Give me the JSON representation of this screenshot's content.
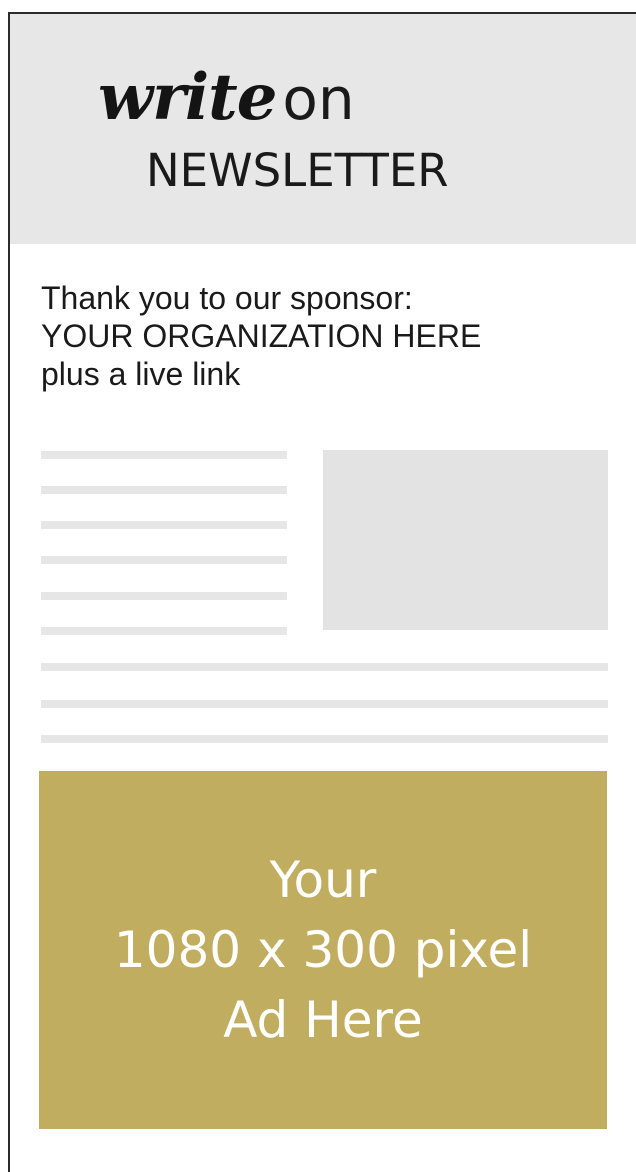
{
  "masthead": {
    "logo_word_1": "write",
    "logo_word_2": "on",
    "logo_subtitle": "NEWSLETTER",
    "background": "#e7e7e7"
  },
  "sponsor": {
    "line_1": "Thank you to our sponsor:",
    "line_2": "YOUR ORGANIZATION HERE",
    "line_3": "plus a live link"
  },
  "ad": {
    "line_1": "Your",
    "line_2": "1080 x 300 pixel",
    "line_3": "Ad Here",
    "background": "#c1ad5f",
    "text_color": "#ffffff"
  },
  "placeholder_color": "#e3e3e3"
}
